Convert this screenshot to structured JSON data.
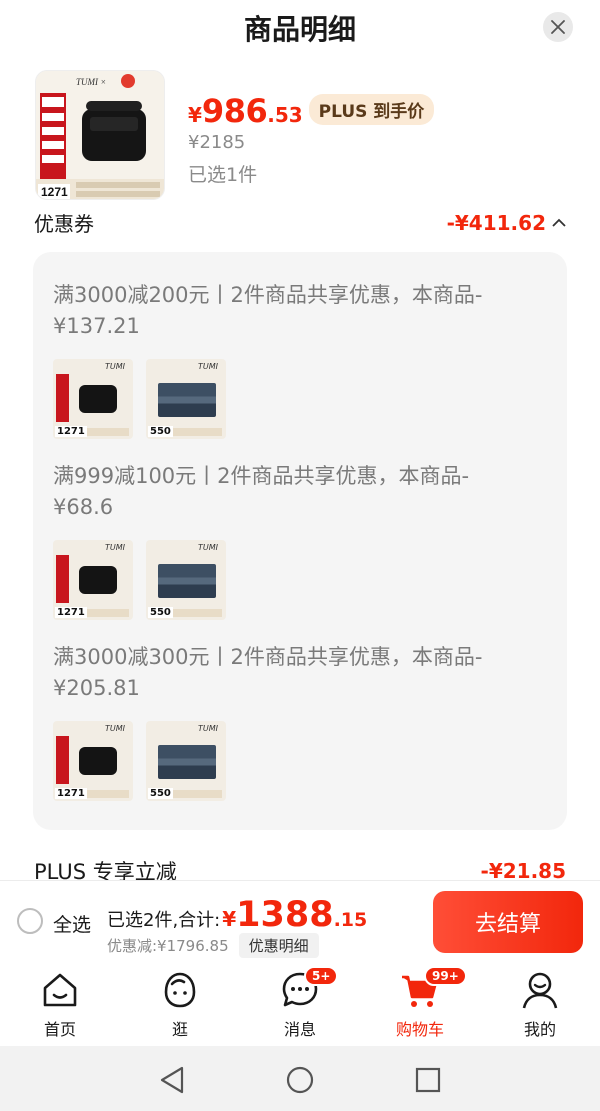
{
  "sheet": {
    "title": "商品明细"
  },
  "product": {
    "price_yen": "¥",
    "price_int": "986",
    "price_dec": ".53",
    "plus_tag": "PLUS 到手价",
    "original_price": "¥2185",
    "selected": "已选1件"
  },
  "coupon": {
    "title": "优惠券",
    "amount": "-¥411.62",
    "items": [
      {
        "desc": "满3000减200元丨2件商品共享优惠，本商品-¥137.21",
        "thumbs": [
          {
            "kind": "bag",
            "badge": "1271"
          },
          {
            "kind": "wallet",
            "badge": "550"
          }
        ]
      },
      {
        "desc": "满999减100元丨2件商品共享优惠，本商品-¥68.6",
        "thumbs": [
          {
            "kind": "bag",
            "badge": "1271"
          },
          {
            "kind": "wallet",
            "badge": "550"
          }
        ]
      },
      {
        "desc": "满3000减300元丨2件商品共享优惠，本商品-¥205.81",
        "thumbs": [
          {
            "kind": "bag",
            "badge": "1271"
          },
          {
            "kind": "wallet",
            "badge": "550"
          }
        ]
      }
    ]
  },
  "plus_discount": {
    "label": "PLUS 专享立减",
    "amount": "-¥21.85"
  },
  "checkout": {
    "select_all": "全选",
    "sum_label": "已选2件,合计:",
    "sum_yen": "¥",
    "sum_int": "1388",
    "sum_dec": ".15",
    "discount": "优惠减:¥1796.85",
    "detail_button": "优惠明细",
    "submit": "去结算"
  },
  "tabbar": [
    {
      "label": "首页",
      "icon": "home-icon"
    },
    {
      "label": "逛",
      "icon": "explore-face-icon"
    },
    {
      "label": "消息",
      "icon": "message-icon",
      "count": "5+"
    },
    {
      "label": "购物车",
      "icon": "cart-icon",
      "count": "99+",
      "active": true
    },
    {
      "label": "我的",
      "icon": "profile-icon"
    }
  ],
  "colors": {
    "accent": "#f2270c",
    "plus_tag_bg": "#fbead6",
    "panel_bg": "#f5f5f5"
  }
}
